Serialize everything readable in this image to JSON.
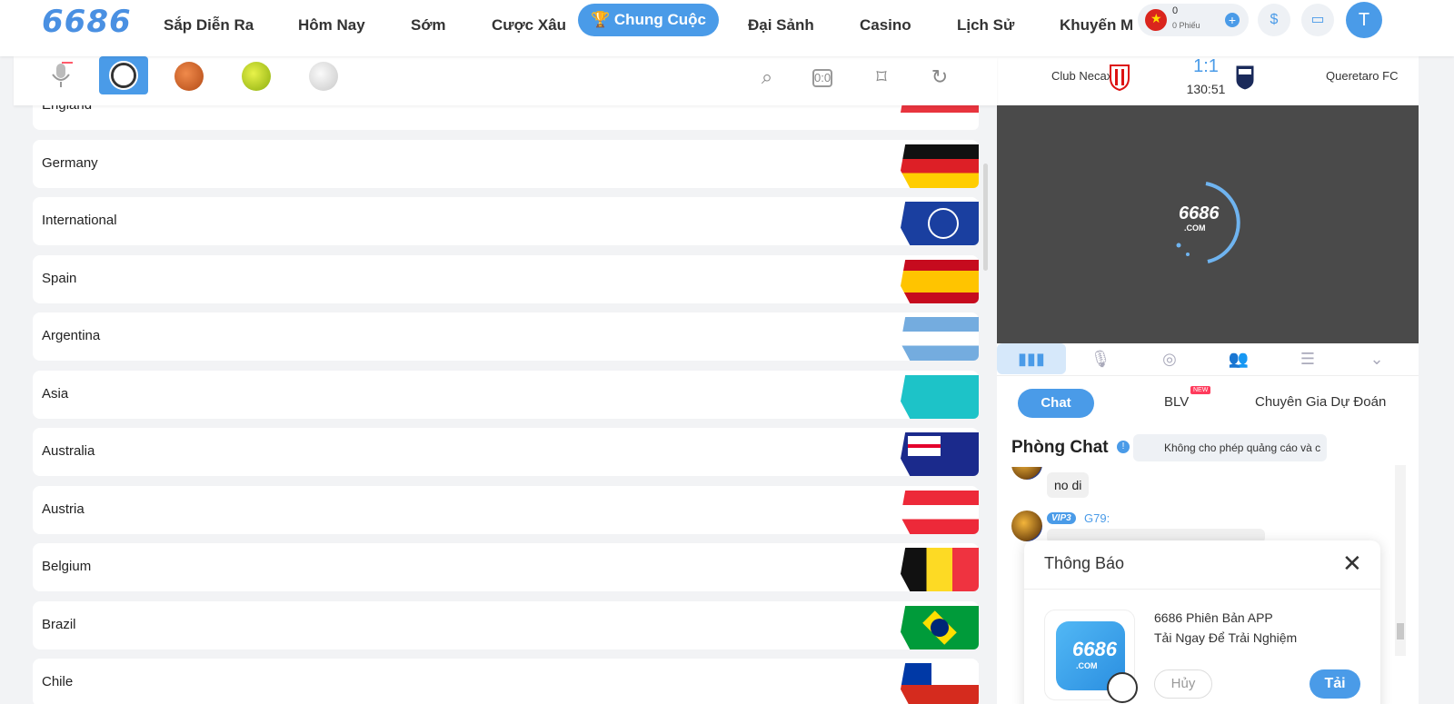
{
  "logo": "6686",
  "nav": {
    "items": [
      "Sắp Diễn Ra",
      "Hôm Nay",
      "Sớm",
      "Cược Xâu"
    ],
    "active": "Chung Cuộc",
    "items_after": [
      "Đại Sảnh",
      "Casino",
      "Lịch Sử"
    ],
    "clipped": "Khuyến Mãi"
  },
  "wallet": {
    "amount": "0",
    "tickets": "0 Phiếu"
  },
  "user_initial": "T",
  "leagues": [
    "England",
    "Germany",
    "International",
    "Spain",
    "Argentina",
    "Asia",
    "Australia",
    "Austria",
    "Belgium",
    "Brazil",
    "Chile"
  ],
  "match": {
    "home": "Club Necaxa",
    "away": "Queretaro FC",
    "score": "1:1",
    "time": "130:51"
  },
  "video": {
    "logo": "6686",
    "sub": ".COM"
  },
  "chat": {
    "tabs": {
      "chat": "Chat",
      "blv": "BLV",
      "blv_badge": "NEW",
      "expert": "Chuyên Gia Dự Đoán"
    },
    "room_title": "Phòng Chat",
    "notice": "Không cho phép quảng cáo và c",
    "messages": [
      {
        "text": "no di"
      },
      {
        "vip": "VIP3",
        "user": "G79:"
      }
    ]
  },
  "dialog": {
    "title": "Thông Báo",
    "line1": "6686 Phiên Bản APP",
    "line2": "Tải Ngay Để Trải Nghiệm",
    "cancel": "Hủy",
    "download": "Tải",
    "app_logo": "6686",
    "app_sub": ".COM"
  },
  "colors": {
    "accent": "#4a9be8",
    "video_bg": "#4a4a4a"
  }
}
